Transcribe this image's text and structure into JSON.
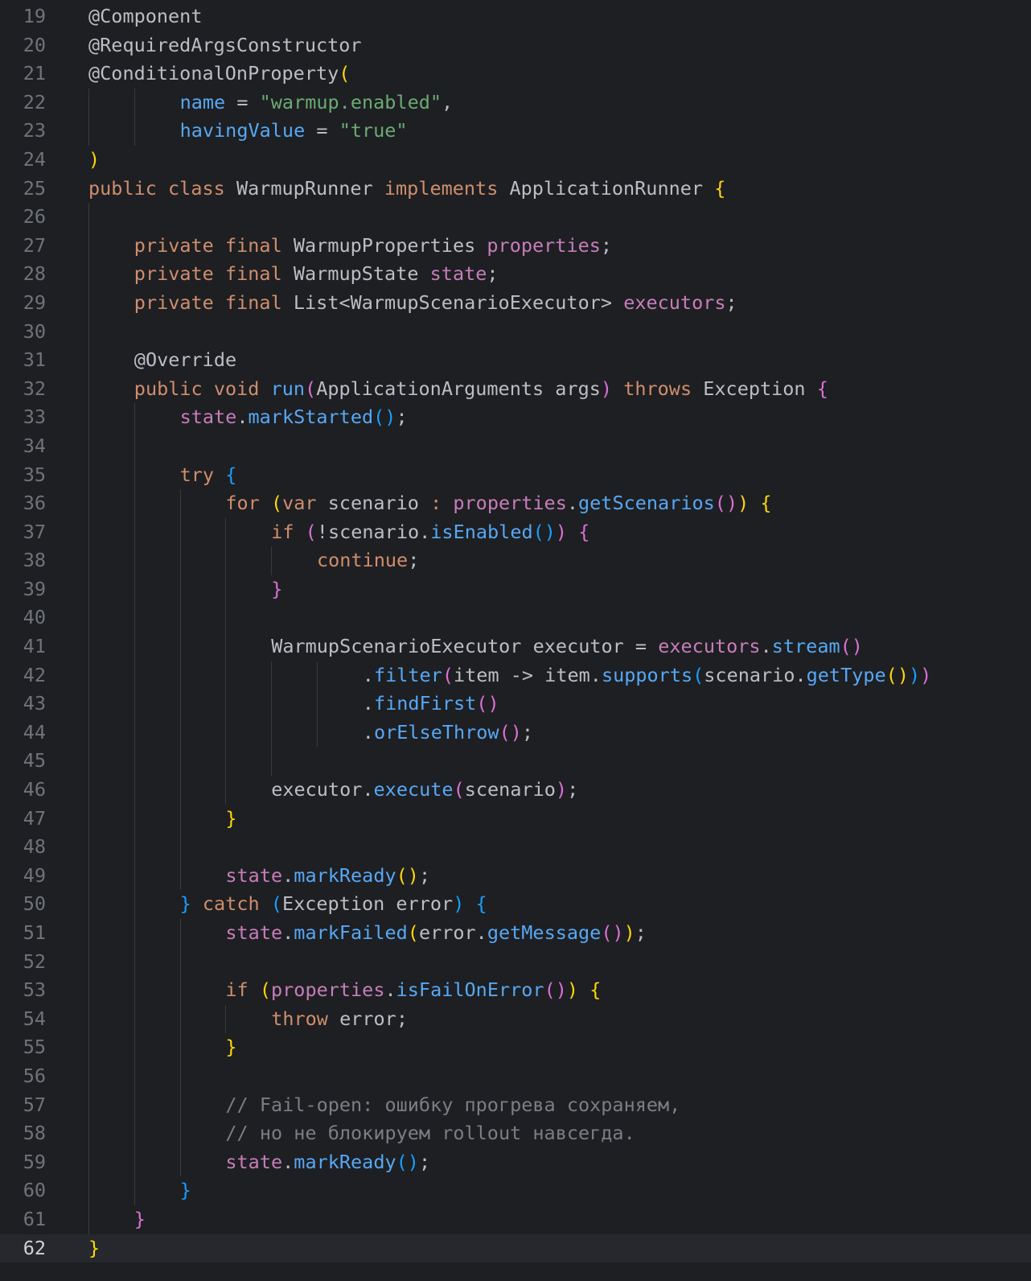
{
  "editor": {
    "current_line": 62,
    "colors": {
      "background": "#1e1f22",
      "current_line_bg": "#26282e",
      "line_number": "#6f737a",
      "default": "#bcbec4",
      "keyword": "#cf8e6d",
      "field": "#c77dbb",
      "method": "#56a8f5",
      "string": "#6aab73",
      "comment": "#7a7e85",
      "bracket_yellow": "#ffd700",
      "bracket_pink": "#da70d6",
      "bracket_blue": "#179fff"
    },
    "lines": [
      {
        "n": 19,
        "indent": 0,
        "guides": [],
        "tokens": [
          [
            "@Component",
            "d"
          ]
        ]
      },
      {
        "n": 20,
        "indent": 0,
        "guides": [],
        "tokens": [
          [
            "@RequiredArgsConstructor",
            "d"
          ]
        ]
      },
      {
        "n": 21,
        "indent": 0,
        "guides": [],
        "tokens": [
          [
            "@ConditionalOnProperty",
            "d"
          ],
          [
            "(",
            "by"
          ]
        ]
      },
      {
        "n": 22,
        "indent": 8,
        "guides": [
          0,
          4
        ],
        "tokens": [
          [
            "name",
            "m"
          ],
          [
            " = ",
            "d"
          ],
          [
            "\"warmup.enabled\"",
            "s"
          ],
          [
            ",",
            "d"
          ]
        ]
      },
      {
        "n": 23,
        "indent": 8,
        "guides": [
          0,
          4
        ],
        "tokens": [
          [
            "havingValue",
            "m"
          ],
          [
            " = ",
            "d"
          ],
          [
            "\"true\"",
            "s"
          ]
        ]
      },
      {
        "n": 24,
        "indent": 0,
        "guides": [],
        "tokens": [
          [
            ")",
            "by"
          ]
        ]
      },
      {
        "n": 25,
        "indent": 0,
        "guides": [],
        "tokens": [
          [
            "public class ",
            "k"
          ],
          [
            "WarmupRunner ",
            "d"
          ],
          [
            "implements ",
            "k"
          ],
          [
            "ApplicationRunner ",
            "d"
          ],
          [
            "{",
            "by"
          ]
        ]
      },
      {
        "n": 26,
        "indent": 0,
        "guides": [
          0
        ],
        "tokens": []
      },
      {
        "n": 27,
        "indent": 4,
        "guides": [
          0
        ],
        "tokens": [
          [
            "private final ",
            "k"
          ],
          [
            "WarmupProperties ",
            "d"
          ],
          [
            "properties",
            "f"
          ],
          [
            ";",
            "d"
          ]
        ]
      },
      {
        "n": 28,
        "indent": 4,
        "guides": [
          0
        ],
        "tokens": [
          [
            "private final ",
            "k"
          ],
          [
            "WarmupState ",
            "d"
          ],
          [
            "state",
            "f"
          ],
          [
            ";",
            "d"
          ]
        ]
      },
      {
        "n": 29,
        "indent": 4,
        "guides": [
          0
        ],
        "tokens": [
          [
            "private final ",
            "k"
          ],
          [
            "List<WarmupScenarioExecutor> ",
            "d"
          ],
          [
            "executors",
            "f"
          ],
          [
            ";",
            "d"
          ]
        ]
      },
      {
        "n": 30,
        "indent": 0,
        "guides": [
          0
        ],
        "tokens": []
      },
      {
        "n": 31,
        "indent": 4,
        "guides": [
          0
        ],
        "tokens": [
          [
            "@Override",
            "d"
          ]
        ]
      },
      {
        "n": 32,
        "indent": 4,
        "guides": [
          0
        ],
        "tokens": [
          [
            "public void ",
            "k"
          ],
          [
            "run",
            "m"
          ],
          [
            "(",
            "bp"
          ],
          [
            "ApplicationArguments args",
            "d"
          ],
          [
            ")",
            "bp"
          ],
          [
            " throws ",
            "k"
          ],
          [
            "Exception ",
            "d"
          ],
          [
            "{",
            "bp"
          ]
        ]
      },
      {
        "n": 33,
        "indent": 8,
        "guides": [
          0,
          4
        ],
        "tokens": [
          [
            "state",
            "f"
          ],
          [
            ".",
            "d"
          ],
          [
            "markStarted",
            "m"
          ],
          [
            "()",
            "bb"
          ],
          [
            ";",
            "d"
          ]
        ]
      },
      {
        "n": 34,
        "indent": 0,
        "guides": [
          0,
          4
        ],
        "tokens": []
      },
      {
        "n": 35,
        "indent": 8,
        "guides": [
          0,
          4
        ],
        "tokens": [
          [
            "try ",
            "k"
          ],
          [
            "{",
            "bb"
          ]
        ]
      },
      {
        "n": 36,
        "indent": 12,
        "guides": [
          0,
          4,
          8
        ],
        "tokens": [
          [
            "for ",
            "k"
          ],
          [
            "(",
            "by"
          ],
          [
            "var ",
            "k"
          ],
          [
            "scenario ",
            "d"
          ],
          [
            ": ",
            "k"
          ],
          [
            "properties",
            "f"
          ],
          [
            ".",
            "d"
          ],
          [
            "getScenarios",
            "m"
          ],
          [
            "()",
            "bp"
          ],
          [
            ")",
            "by"
          ],
          [
            " ",
            "d"
          ],
          [
            "{",
            "by"
          ]
        ]
      },
      {
        "n": 37,
        "indent": 16,
        "guides": [
          0,
          4,
          8,
          12
        ],
        "tokens": [
          [
            "if ",
            "k"
          ],
          [
            "(",
            "bp"
          ],
          [
            "!scenario.",
            "d"
          ],
          [
            "isEnabled",
            "m"
          ],
          [
            "()",
            "bb"
          ],
          [
            ")",
            "bp"
          ],
          [
            " ",
            "d"
          ],
          [
            "{",
            "bp"
          ]
        ]
      },
      {
        "n": 38,
        "indent": 20,
        "guides": [
          0,
          4,
          8,
          12,
          16
        ],
        "tokens": [
          [
            "continue",
            "k"
          ],
          [
            ";",
            "d"
          ]
        ]
      },
      {
        "n": 39,
        "indent": 16,
        "guides": [
          0,
          4,
          8,
          12
        ],
        "tokens": [
          [
            "}",
            "bp"
          ]
        ]
      },
      {
        "n": 40,
        "indent": 0,
        "guides": [
          0,
          4,
          8,
          12
        ],
        "tokens": []
      },
      {
        "n": 41,
        "indent": 16,
        "guides": [
          0,
          4,
          8,
          12
        ],
        "tokens": [
          [
            "WarmupScenarioExecutor executor = ",
            "d"
          ],
          [
            "executors",
            "f"
          ],
          [
            ".",
            "d"
          ],
          [
            "stream",
            "m"
          ],
          [
            "()",
            "bp"
          ]
        ]
      },
      {
        "n": 42,
        "indent": 24,
        "guides": [
          0,
          4,
          8,
          12,
          16,
          20
        ],
        "tokens": [
          [
            ".",
            "d"
          ],
          [
            "filter",
            "m"
          ],
          [
            "(",
            "bp"
          ],
          [
            "item -> item.",
            "d"
          ],
          [
            "supports",
            "m"
          ],
          [
            "(",
            "bb"
          ],
          [
            "scenario.",
            "d"
          ],
          [
            "getType",
            "m"
          ],
          [
            "()",
            "by"
          ],
          [
            ")",
            "bb"
          ],
          [
            ")",
            "bp"
          ]
        ]
      },
      {
        "n": 43,
        "indent": 24,
        "guides": [
          0,
          4,
          8,
          12,
          16,
          20
        ],
        "tokens": [
          [
            ".",
            "d"
          ],
          [
            "findFirst",
            "m"
          ],
          [
            "()",
            "bp"
          ]
        ]
      },
      {
        "n": 44,
        "indent": 24,
        "guides": [
          0,
          4,
          8,
          12,
          16,
          20
        ],
        "tokens": [
          [
            ".",
            "d"
          ],
          [
            "orElseThrow",
            "m"
          ],
          [
            "()",
            "bp"
          ],
          [
            ";",
            "d"
          ]
        ]
      },
      {
        "n": 45,
        "indent": 0,
        "guides": [
          0,
          4,
          8,
          12,
          16
        ],
        "tokens": []
      },
      {
        "n": 46,
        "indent": 16,
        "guides": [
          0,
          4,
          8,
          12
        ],
        "tokens": [
          [
            "executor.",
            "d"
          ],
          [
            "execute",
            "m"
          ],
          [
            "(",
            "bp"
          ],
          [
            "scenario",
            "d"
          ],
          [
            ")",
            "bp"
          ],
          [
            ";",
            "d"
          ]
        ]
      },
      {
        "n": 47,
        "indent": 12,
        "guides": [
          0,
          4,
          8
        ],
        "tokens": [
          [
            "}",
            "by"
          ]
        ]
      },
      {
        "n": 48,
        "indent": 0,
        "guides": [
          0,
          4,
          8
        ],
        "tokens": []
      },
      {
        "n": 49,
        "indent": 12,
        "guides": [
          0,
          4,
          8
        ],
        "tokens": [
          [
            "state",
            "f"
          ],
          [
            ".",
            "d"
          ],
          [
            "markReady",
            "m"
          ],
          [
            "()",
            "by"
          ],
          [
            ";",
            "d"
          ]
        ]
      },
      {
        "n": 50,
        "indent": 8,
        "guides": [
          0,
          4
        ],
        "tokens": [
          [
            "}",
            "bb"
          ],
          [
            " catch ",
            "k"
          ],
          [
            "(",
            "bb"
          ],
          [
            "Exception error",
            "d"
          ],
          [
            ")",
            "bb"
          ],
          [
            " ",
            "d"
          ],
          [
            "{",
            "bb"
          ]
        ]
      },
      {
        "n": 51,
        "indent": 12,
        "guides": [
          0,
          4,
          8
        ],
        "tokens": [
          [
            "state",
            "f"
          ],
          [
            ".",
            "d"
          ],
          [
            "markFailed",
            "m"
          ],
          [
            "(",
            "by"
          ],
          [
            "error.",
            "d"
          ],
          [
            "getMessage",
            "m"
          ],
          [
            "()",
            "bp"
          ],
          [
            ")",
            "by"
          ],
          [
            ";",
            "d"
          ]
        ]
      },
      {
        "n": 52,
        "indent": 0,
        "guides": [
          0,
          4,
          8
        ],
        "tokens": []
      },
      {
        "n": 53,
        "indent": 12,
        "guides": [
          0,
          4,
          8
        ],
        "tokens": [
          [
            "if ",
            "k"
          ],
          [
            "(",
            "by"
          ],
          [
            "properties",
            "f"
          ],
          [
            ".",
            "d"
          ],
          [
            "isFailOnError",
            "m"
          ],
          [
            "()",
            "bp"
          ],
          [
            ")",
            "by"
          ],
          [
            " ",
            "d"
          ],
          [
            "{",
            "by"
          ]
        ]
      },
      {
        "n": 54,
        "indent": 16,
        "guides": [
          0,
          4,
          8,
          12
        ],
        "tokens": [
          [
            "throw ",
            "k"
          ],
          [
            "error;",
            "d"
          ]
        ]
      },
      {
        "n": 55,
        "indent": 12,
        "guides": [
          0,
          4,
          8
        ],
        "tokens": [
          [
            "}",
            "by"
          ]
        ]
      },
      {
        "n": 56,
        "indent": 0,
        "guides": [
          0,
          4,
          8
        ],
        "tokens": []
      },
      {
        "n": 57,
        "indent": 12,
        "guides": [
          0,
          4,
          8
        ],
        "tokens": [
          [
            "// Fail-open: ошибку прогрева сохраняем,",
            "c"
          ]
        ]
      },
      {
        "n": 58,
        "indent": 12,
        "guides": [
          0,
          4,
          8
        ],
        "tokens": [
          [
            "// но не блокируем rollout навсегда.",
            "c"
          ]
        ]
      },
      {
        "n": 59,
        "indent": 12,
        "guides": [
          0,
          4,
          8
        ],
        "tokens": [
          [
            "state",
            "f"
          ],
          [
            ".",
            "d"
          ],
          [
            "markReady",
            "m"
          ],
          [
            "()",
            "bb"
          ],
          [
            ";",
            "d"
          ]
        ]
      },
      {
        "n": 60,
        "indent": 8,
        "guides": [
          0,
          4
        ],
        "tokens": [
          [
            "}",
            "bb"
          ]
        ]
      },
      {
        "n": 61,
        "indent": 4,
        "guides": [
          0
        ],
        "tokens": [
          [
            "}",
            "bp"
          ]
        ]
      },
      {
        "n": 62,
        "indent": 0,
        "guides": [],
        "tokens": [
          [
            "}",
            "by"
          ]
        ]
      }
    ]
  }
}
